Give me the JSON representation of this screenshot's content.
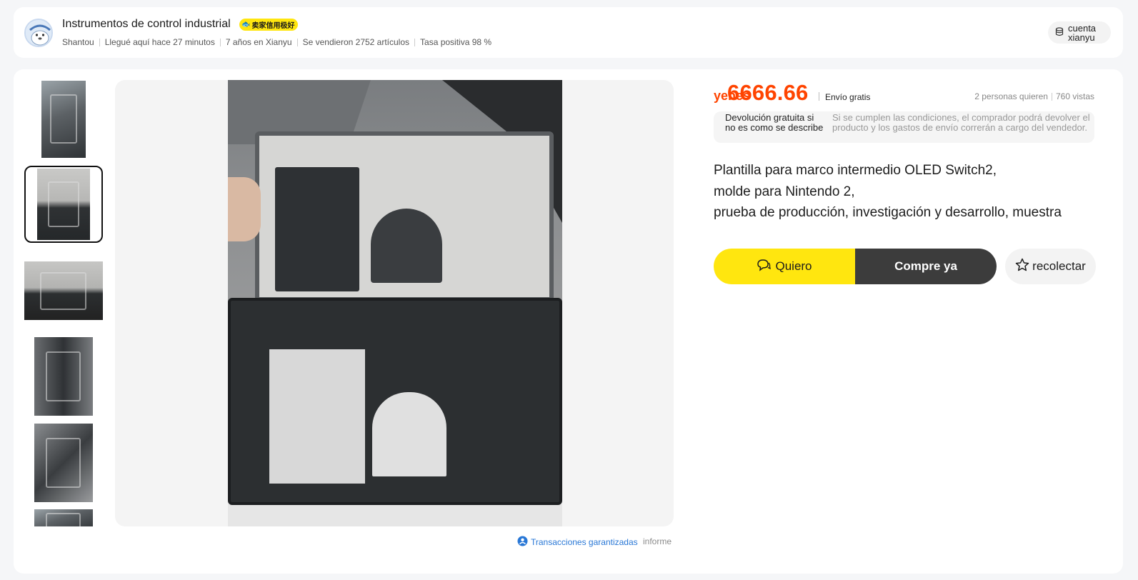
{
  "seller": {
    "name": "Instrumentos de control industrial",
    "badge": "卖家信用极好",
    "location": "Shantou",
    "arrived": "Llegué aquí hace 27 minutos",
    "years": "7 años en Xianyu",
    "sold": "Se vendieron 2752 artículos",
    "positive_rate": "Tasa positiva 98 %"
  },
  "account": {
    "label": "cuenta xianyu",
    "icon": "cylinder-icon"
  },
  "product": {
    "currency": "yenes",
    "price": "6666.66",
    "shipping": "Envío gratis",
    "wants": "2 personas quieren",
    "views": "760 vistas",
    "return_title": "Devolución gratuita si no es como se describe",
    "return_desc": "Si se cumplen las condiciones, el comprador podrá devolver el producto y los gastos de envío correrán a cargo del vendedor.",
    "title_lines": [
      "Plantilla para marco intermedio OLED Switch2,",
      "molde para Nintendo 2,",
      "prueba de producción, investigación y desarrollo, muestra"
    ]
  },
  "actions": {
    "want": "Quiero",
    "buy": "Compre ya",
    "collect": "recolectar"
  },
  "footer": {
    "guarantee": "Transacciones garantizadas",
    "report": "informe"
  },
  "colors": {
    "accent_yellow": "#ffe60f",
    "price_orange": "#ff4400",
    "buy_dark": "#3c3c3c",
    "link_blue": "#2877d6"
  }
}
